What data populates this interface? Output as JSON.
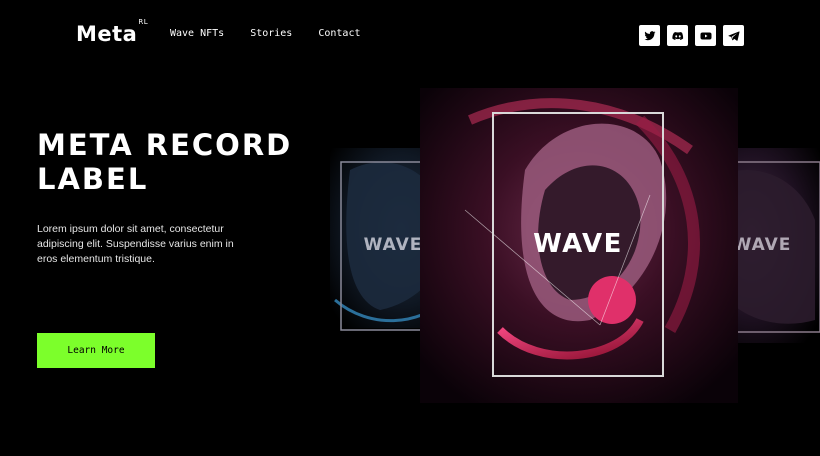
{
  "brand": {
    "name": "Meta",
    "superscript": "RL"
  },
  "nav": {
    "items": [
      "Wave NFTs",
      "Stories",
      "Contact"
    ]
  },
  "socials": [
    {
      "icon": "twitter-icon"
    },
    {
      "icon": "discord-icon"
    },
    {
      "icon": "youtube-icon"
    },
    {
      "icon": "telegram-icon"
    }
  ],
  "hero": {
    "title": "META RECORD LABEL",
    "description": "Lorem ipsum dolor sit amet, consectetur adipiscing elit. Suspendisse varius enim in eros elementum tristique.",
    "cta_label": "Learn More"
  },
  "cards": {
    "left_label": "WAVE",
    "center_label": "WAVE",
    "right_label": "WAVE"
  },
  "colors": {
    "accent": "#7cff2b",
    "background": "#000000",
    "card_pink": "#e0306a",
    "card_blue": "#2a4f7a"
  }
}
